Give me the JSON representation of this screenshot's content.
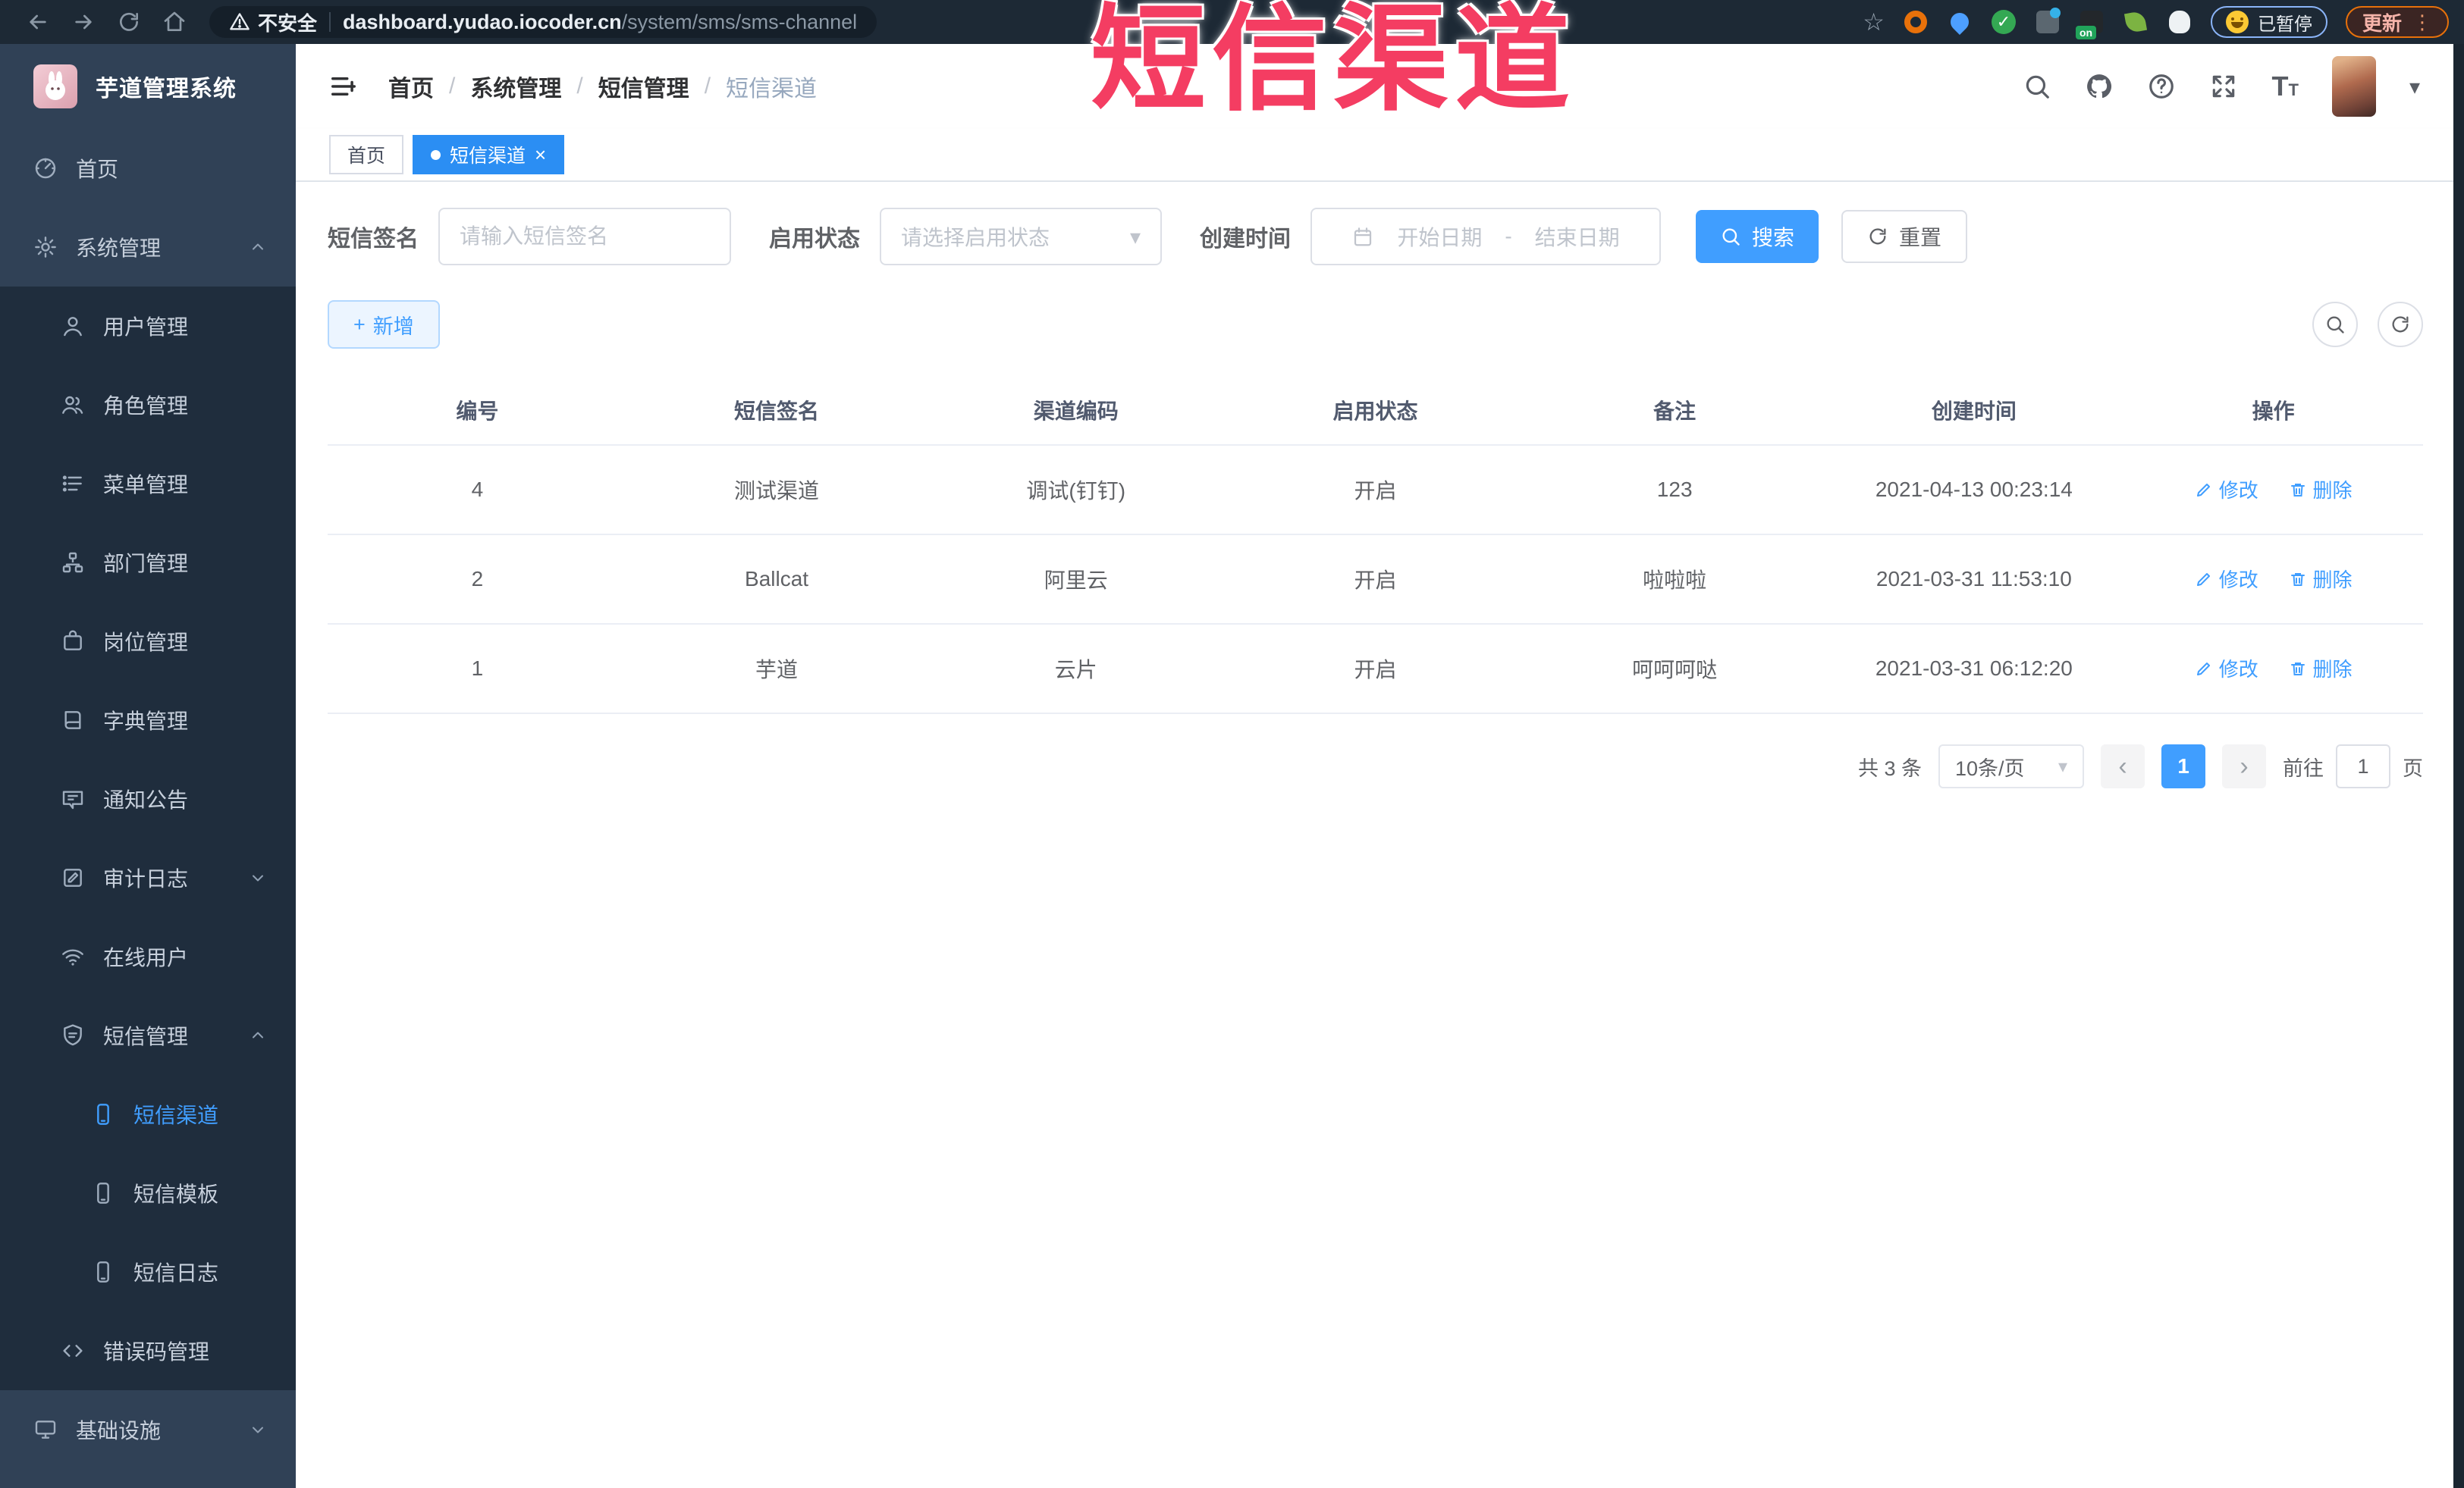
{
  "overlay": {
    "title": "短信渠道"
  },
  "browser": {
    "security_label": "不安全",
    "url_domain": "dashboard.yudao.iocoder.cn",
    "url_path": "/system/sms/sms-channel",
    "extension_badge": "on",
    "paused_badge": "已暂停",
    "update_button": "更新"
  },
  "glyphs": {
    "star": "☆",
    "dots_vertical": "⋮",
    "caret_down": "▾",
    "close": "×",
    "separator": "/",
    "dash": "-",
    "plus": "+",
    "prev": "‹",
    "next": "›",
    "check": "✓",
    "font_big": "T",
    "font_small": "T"
  },
  "sidebar": {
    "app_title": "芋道管理系统",
    "items": [
      {
        "label": "首页",
        "icon": "dashboard-icon"
      },
      {
        "label": "系统管理",
        "icon": "gear-icon"
      },
      {
        "label": "用户管理",
        "icon": "user-icon"
      },
      {
        "label": "角色管理",
        "icon": "role-icon"
      },
      {
        "label": "菜单管理",
        "icon": "menu-icon"
      },
      {
        "label": "部门管理",
        "icon": "dept-icon"
      },
      {
        "label": "岗位管理",
        "icon": "post-icon"
      },
      {
        "label": "字典管理",
        "icon": "dict-icon"
      },
      {
        "label": "通知公告",
        "icon": "notice-icon"
      },
      {
        "label": "审计日志",
        "icon": "audit-icon"
      },
      {
        "label": "在线用户",
        "icon": "online-icon"
      },
      {
        "label": "短信管理",
        "icon": "sms-icon"
      },
      {
        "label": "短信渠道",
        "icon": "phone-icon"
      },
      {
        "label": "短信模板",
        "icon": "phone-icon"
      },
      {
        "label": "短信日志",
        "icon": "phone-icon"
      },
      {
        "label": "错误码管理",
        "icon": "code-icon"
      },
      {
        "label": "基础设施",
        "icon": "infra-icon"
      }
    ]
  },
  "header": {
    "breadcrumb": [
      "首页",
      "系统管理",
      "短信管理",
      "短信渠道"
    ]
  },
  "tags": {
    "home": "首页",
    "current": "短信渠道"
  },
  "search_form": {
    "signature_label": "短信签名",
    "signature_placeholder": "请输入短信签名",
    "status_label": "启用状态",
    "status_placeholder": "请选择启用状态",
    "time_label": "创建时间",
    "date_start_placeholder": "开始日期",
    "date_end_placeholder": "结束日期",
    "search_button": "搜索",
    "reset_button": "重置"
  },
  "toolbar": {
    "add_button": "新增"
  },
  "table": {
    "columns": [
      "编号",
      "短信签名",
      "渠道编码",
      "启用状态",
      "备注",
      "创建时间",
      "操作"
    ],
    "edit_label": "修改",
    "delete_label": "删除",
    "rows": [
      {
        "id": "4",
        "signature": "测试渠道",
        "code": "调试(钉钉)",
        "status": "开启",
        "remark": "123",
        "created": "2021-04-13 00:23:14"
      },
      {
        "id": "2",
        "signature": "Ballcat",
        "code": "阿里云",
        "status": "开启",
        "remark": "啦啦啦",
        "created": "2021-03-31 11:53:10"
      },
      {
        "id": "1",
        "signature": "芋道",
        "code": "云片",
        "status": "开启",
        "remark": "呵呵呵哒",
        "created": "2021-03-31 06:12:20"
      }
    ]
  },
  "pagination": {
    "total": "共 3 条",
    "page_size": "10条/页",
    "current_page": "1",
    "goto_label": "前往",
    "goto_value": "1",
    "page_unit": "页"
  }
}
